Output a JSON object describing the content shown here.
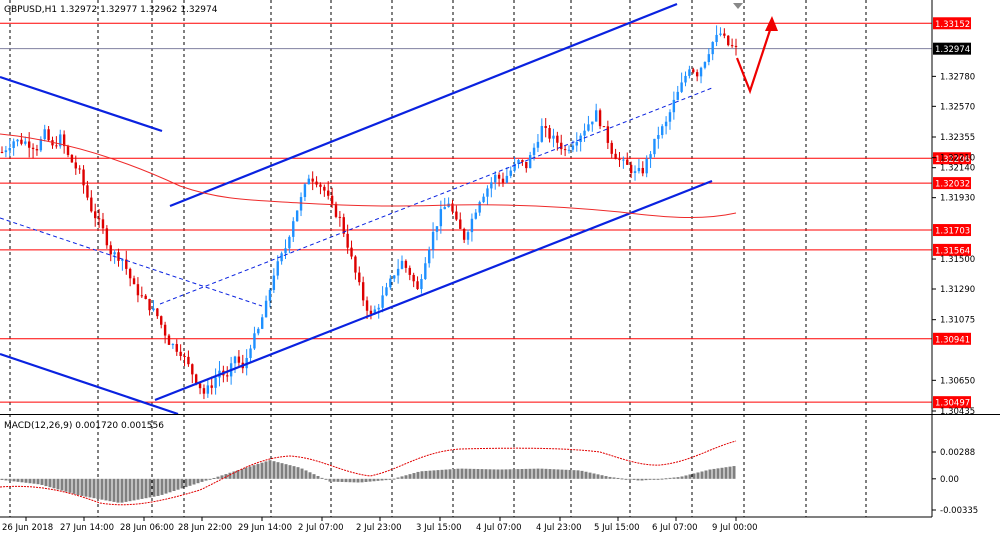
{
  "chart_data": {
    "type": "candlestick",
    "symbol_header": "GBPUSD,H1  1.32972 1.32977 1.32962 1.32974",
    "price_axis": {
      "ylim": [
        1.30435,
        1.3221
      ],
      "ticks": [
        "1.32210",
        "1.31930",
        "1.32570",
        "1.32780",
        "1.32355",
        "1.32140",
        "1.31500",
        "1.31290",
        "1.31075",
        "1.30650",
        "1.30435"
      ],
      "tick_values": [
        1.3221,
        1.3193,
        1.3257,
        1.3278,
        1.32355,
        1.3214,
        1.315,
        1.3129,
        1.31075,
        1.3065,
        1.30435
      ]
    },
    "time_labels": [
      "26 Jun 2018",
      "27 Jun 14:00",
      "28 Jun 06:00",
      "28 Jun 22:00",
      "29 Jun 14:00",
      "2 Jul 07:00",
      "2 Jul 23:00",
      "3 Jul 15:00",
      "4 Jul 07:00",
      "4 Jul 23:00",
      "5 Jul 15:00",
      "6 Jul 07:00",
      "9 Jul 00:00"
    ],
    "levels": [
      {
        "label": "1.33152",
        "value": 1.33152,
        "color": "#ff0000"
      },
      {
        "label": "1.32206",
        "value": 1.32206,
        "color": "#ff0000"
      },
      {
        "label": "1.32032",
        "value": 1.32032,
        "color": "#ff0000"
      },
      {
        "label": "1.31703",
        "value": 1.31703,
        "color": "#ff0000"
      },
      {
        "label": "1.31564",
        "value": 1.31564,
        "color": "#ff0000"
      },
      {
        "label": "1.30941",
        "value": 1.30941,
        "color": "#ff0000"
      },
      {
        "label": "1.30497",
        "value": 1.30497,
        "color": "#ff0000"
      }
    ],
    "current_price": {
      "label": "1.32974",
      "value": 1.32974
    },
    "series_path": [
      [
        0,
        1.3225
      ],
      [
        6,
        1.3233
      ],
      [
        12,
        1.3232
      ],
      [
        18,
        1.3228
      ],
      [
        22,
        1.3238
      ],
      [
        26,
        1.3228
      ],
      [
        30,
        1.3235
      ],
      [
        34,
        1.3222
      ],
      [
        40,
        1.321
      ],
      [
        46,
        1.3185
      ],
      [
        52,
        1.317
      ],
      [
        56,
        1.3155
      ],
      [
        62,
        1.315
      ],
      [
        68,
        1.313
      ],
      [
        74,
        1.312
      ],
      [
        80,
        1.311
      ],
      [
        86,
        1.3092
      ],
      [
        92,
        1.3085
      ],
      [
        98,
        1.307
      ],
      [
        104,
        1.3056
      ],
      [
        108,
        1.3062
      ],
      [
        112,
        1.3072
      ],
      [
        116,
        1.3066
      ],
      [
        120,
        1.3082
      ],
      [
        124,
        1.3072
      ],
      [
        128,
        1.309
      ],
      [
        132,
        1.31
      ],
      [
        136,
        1.3118
      ],
      [
        140,
        1.314
      ],
      [
        146,
        1.3158
      ],
      [
        150,
        1.3178
      ],
      [
        154,
        1.3192
      ],
      [
        158,
        1.3208
      ],
      [
        162,
        1.3205
      ],
      [
        166,
        1.3198
      ],
      [
        170,
        1.3186
      ],
      [
        174,
        1.3178
      ],
      [
        178,
        1.316
      ],
      [
        182,
        1.314
      ],
      [
        186,
        1.3122
      ],
      [
        190,
        1.311
      ],
      [
        194,
        1.3118
      ],
      [
        198,
        1.3128
      ],
      [
        202,
        1.314
      ],
      [
        206,
        1.3148
      ],
      [
        210,
        1.314
      ],
      [
        214,
        1.3128
      ],
      [
        218,
        1.315
      ],
      [
        222,
        1.3168
      ],
      [
        226,
        1.3182
      ],
      [
        230,
        1.319
      ],
      [
        234,
        1.3175
      ],
      [
        238,
        1.3165
      ],
      [
        242,
        1.3178
      ],
      [
        246,
        1.3192
      ],
      [
        250,
        1.32
      ],
      [
        254,
        1.3208
      ],
      [
        258,
        1.3205
      ],
      [
        262,
        1.3212
      ],
      [
        266,
        1.3218
      ],
      [
        270,
        1.3215
      ],
      [
        274,
        1.3228
      ],
      [
        278,
        1.3242
      ],
      [
        282,
        1.3236
      ],
      [
        286,
        1.3232
      ],
      [
        290,
        1.3226
      ],
      [
        294,
        1.3232
      ],
      [
        298,
        1.3238
      ],
      [
        302,
        1.3245
      ],
      [
        306,
        1.3252
      ],
      [
        310,
        1.324
      ],
      [
        314,
        1.3226
      ],
      [
        318,
        1.3219
      ],
      [
        322,
        1.3215
      ],
      [
        326,
        1.321
      ],
      [
        330,
        1.3212
      ],
      [
        334,
        1.3225
      ],
      [
        338,
        1.3238
      ],
      [
        342,
        1.3245
      ],
      [
        346,
        1.326
      ],
      [
        350,
        1.3272
      ],
      [
        354,
        1.3285
      ],
      [
        358,
        1.328
      ],
      [
        362,
        1.329
      ],
      [
        366,
        1.3302
      ],
      [
        370,
        1.3308
      ],
      [
        374,
        1.33
      ],
      [
        378,
        1.3297
      ]
    ],
    "channel_lines": [
      {
        "x1": 170,
        "y1": 206,
        "x2": 677,
        "y2": 4
      },
      {
        "x1": 155,
        "y1": 400,
        "x2": 712,
        "y2": 181
      },
      {
        "x1": 0,
        "y1": 77,
        "x2": 162,
        "y2": 131
      },
      {
        "x1": 0,
        "y1": 354,
        "x2": 178,
        "y2": 414
      }
    ],
    "macd": {
      "label": "MACD(12,26,9) 0.001720 0.001556",
      "ticks": [
        "0.00288",
        "0.00",
        "-0.00335"
      ],
      "tick_values": [
        0.00288,
        0.0,
        -0.00335
      ],
      "ylim": [
        -0.00335,
        0.00288
      ]
    }
  }
}
